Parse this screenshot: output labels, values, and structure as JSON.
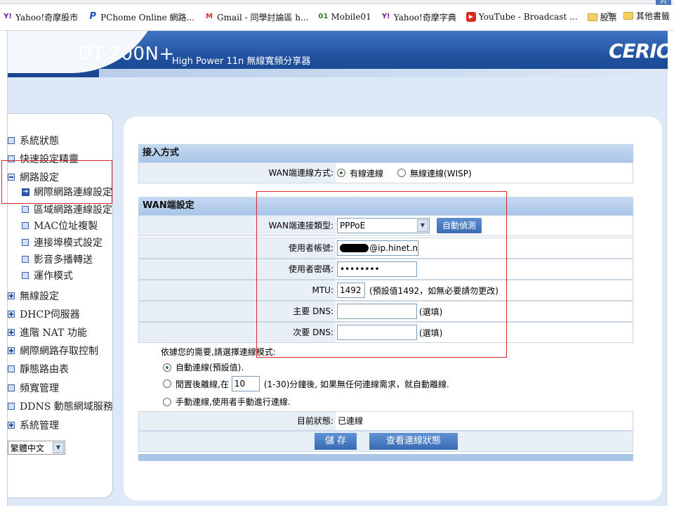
{
  "bookmarks": {
    "items": [
      {
        "icon": "yahoo-icon",
        "label": "Yahoo!奇摩股市"
      },
      {
        "icon": "pchome-icon",
        "label": "PChome Online 網路..."
      },
      {
        "icon": "gmail-icon",
        "label": "Gmail - 同學討論區 h..."
      },
      {
        "icon": "mobile01-icon",
        "label": "Mobile01"
      },
      {
        "icon": "yahoo-icon",
        "label": "Yahoo!奇摩字典"
      },
      {
        "icon": "youtube-icon",
        "label": "YouTube - Broadcast ..."
      },
      {
        "icon": "folder-icon",
        "label": "股票"
      }
    ],
    "more": "»",
    "other": "其他書籤",
    "ext_badge": "IPX"
  },
  "banner": {
    "model": "DT-200N+",
    "subtitle": "High Power 11n 無線寬頻分享器",
    "brand": "CERIO"
  },
  "sidebar": {
    "items": [
      {
        "label": "系統狀態",
        "type": "doc"
      },
      {
        "label": "快速設定精靈",
        "type": "doc"
      },
      {
        "label": "網路設定",
        "type": "minus"
      },
      {
        "label": "網際網路連線設定",
        "type": "active"
      },
      {
        "label": "區域網路連線設定",
        "type": "doc"
      },
      {
        "label": "MAC位址複製",
        "type": "doc"
      },
      {
        "label": "連接埠模式設定",
        "type": "doc"
      },
      {
        "label": "影音多播轉送",
        "type": "doc"
      },
      {
        "label": "運作模式",
        "type": "doc"
      },
      {
        "label": "無線設定",
        "type": "plus"
      },
      {
        "label": "DHCP伺服器",
        "type": "plus"
      },
      {
        "label": "進階 NAT 功能",
        "type": "plus"
      },
      {
        "label": "網際網路存取控制",
        "type": "plus"
      },
      {
        "label": "靜態路由表",
        "type": "doc"
      },
      {
        "label": "頻寬管理",
        "type": "doc"
      },
      {
        "label": "DDNS 動態網域服務",
        "type": "doc"
      },
      {
        "label": "系統管理",
        "type": "plus"
      }
    ],
    "language": "繁體中文"
  },
  "access": {
    "header": "接入方式",
    "wan_mode_label": "WAN端連線方式:",
    "wired": "有線連線",
    "wireless": "無線連線(WISP)"
  },
  "wan": {
    "header": "WAN端設定",
    "type_label": "WAN端連接類型:",
    "type_value": "PPPoE",
    "auto_detect": "自動偵測",
    "user_label": "使用者帳號:",
    "user_value": "@ip.hinet.n",
    "pass_label": "使用者密碼:",
    "pass_value": "••••••••",
    "mtu_label": "MTU:",
    "mtu_value": "1492",
    "mtu_hint": "(預設值1492，如無必要請勿更改)",
    "dns1_label": "主要 DNS:",
    "dns2_label": "次要 DNS:",
    "optional": "(選填)"
  },
  "mode": {
    "prompt": "依據您的需要,請選擇連線模式:",
    "auto": "自動連線(預設值).",
    "idle_pre": "閒置後離線,在",
    "idle_value": "10",
    "idle_post": "(1-30)分鐘後, 如果無任何連線需求，就自動離線.",
    "manual": "手動連線,使用者手動進行連線."
  },
  "status": {
    "label": "目前狀態:",
    "value": "已連線"
  },
  "buttons": {
    "save": "儲 存",
    "view_status": "查看連線狀態"
  }
}
